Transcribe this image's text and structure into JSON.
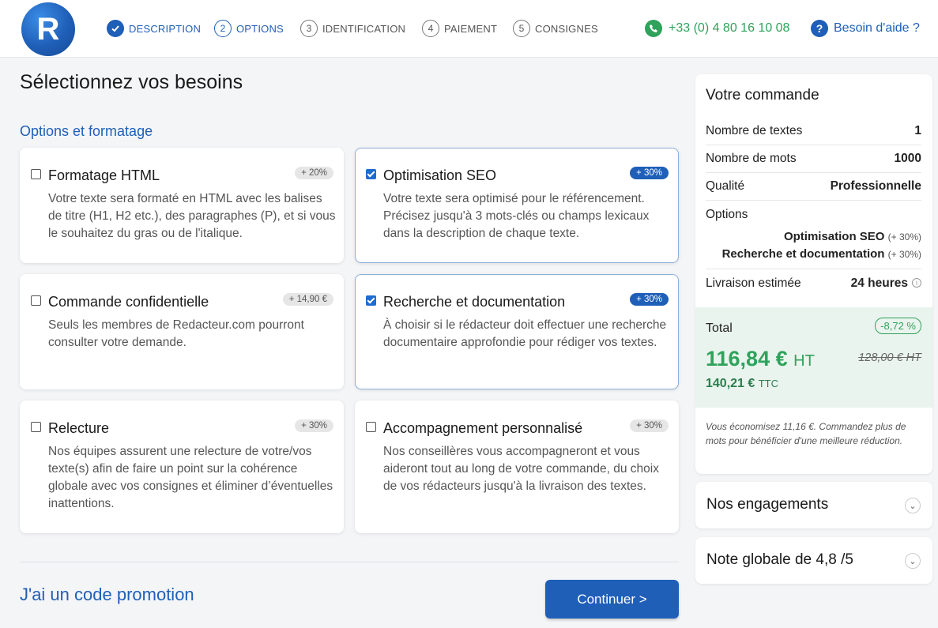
{
  "header": {
    "logo_letter": "R",
    "steps": [
      {
        "num": "1",
        "label": "DESCRIPTION",
        "state": "done"
      },
      {
        "num": "2",
        "label": "OPTIONS",
        "state": "active"
      },
      {
        "num": "3",
        "label": "IDENTIFICATION",
        "state": "todo"
      },
      {
        "num": "4",
        "label": "PAIEMENT",
        "state": "todo"
      },
      {
        "num": "5",
        "label": "CONSIGNES",
        "state": "todo"
      }
    ],
    "phone": "+33 (0) 4 80 16 10 08",
    "help": "Besoin d'aide ?",
    "help_icon": "?"
  },
  "main": {
    "title": "Sélectionnez vos besoins",
    "section": "Options et formatage",
    "options": [
      {
        "title": "Formatage HTML",
        "badge": "+ 20%",
        "checked": false,
        "desc": "Votre texte sera formaté en HTML avec les balises de titre (H1, H2 etc.), des paragraphes (P), et si vous le souhaitez du gras ou de l'italique."
      },
      {
        "title": "Optimisation SEO",
        "badge": "+ 30%",
        "checked": true,
        "desc": "Votre texte sera optimisé pour le référencement. Précisez jusqu'à 3 mots-clés ou champs lexicaux dans la description de chaque texte."
      },
      {
        "title": "Commande confidentielle",
        "badge": "+ 14,90 €",
        "checked": false,
        "desc": "Seuls les membres de Redacteur.com pourront consulter votre demande."
      },
      {
        "title": "Recherche et documentation",
        "badge": "+ 30%",
        "checked": true,
        "desc": "À choisir si le rédacteur doit effectuer une recherche documentaire approfondie pour rédiger vos textes."
      },
      {
        "title": "Relecture",
        "badge": "+ 30%",
        "checked": false,
        "desc": "Nos équipes assurent une relecture de votre/vos texte(s) afin de faire un point sur la cohérence globale avec vos consignes et éliminer d’éventuelles inattentions."
      },
      {
        "title": "Accompagnement personnalisé",
        "badge": "+ 30%",
        "checked": false,
        "desc": "Nos conseillères vous accompagneront et vous aideront tout au long de votre commande, du choix de vos rédacteurs jusqu'à la livraison des textes."
      }
    ],
    "promo": "J'ai un code promotion",
    "continue": "Continuer >"
  },
  "order": {
    "title": "Votre commande",
    "rows": [
      {
        "k": "Nombre de textes",
        "v": "1"
      },
      {
        "k": "Nombre de mots",
        "v": "1000"
      },
      {
        "k": "Qualité",
        "v": "Professionnelle"
      }
    ],
    "options_label": "Options",
    "selected_options": [
      {
        "name": "Optimisation SEO",
        "pct": "(+ 30%)"
      },
      {
        "name": "Recherche et documentation",
        "pct": "(+ 30%)"
      }
    ],
    "delivery_label": "Livraison estimée",
    "delivery_value": "24 heures",
    "info_icon": "i",
    "total_label": "Total",
    "discount": "-8,72 %",
    "price_ht": "116,84 €",
    "ht_suffix": "HT",
    "old_price": "128,00 € HT",
    "price_ttc": "140,21 €",
    "ttc_suffix": "TTC",
    "saving_note": "Vous économisez 11,16 €. Commandez plus de mots pour bénéficier d'une meilleure réduction."
  },
  "accordions": [
    {
      "title": "Nos engagements"
    },
    {
      "title": "Note globale de 4,8 /5"
    }
  ],
  "chevron": "⌄",
  "colors": {
    "brand": "#1f5fb8",
    "green": "#2fa35c"
  }
}
